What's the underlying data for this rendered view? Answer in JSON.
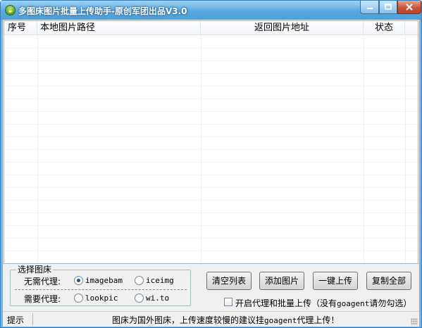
{
  "window": {
    "title": "多图床图片批量上传助手-原创军团出品V3.0",
    "controls": {
      "minimize": "—",
      "maximize": "☐",
      "close": "✕"
    }
  },
  "list": {
    "columns": [
      "序号",
      "本地图片路径",
      "返回图片地址",
      "状态"
    ],
    "rows": []
  },
  "host_group": {
    "title": "选择图床",
    "no_proxy_label": "无需代理:",
    "proxy_label": "需要代理:",
    "options": {
      "imagebam": {
        "label": "imagebam",
        "checked": true
      },
      "iceimg": {
        "label": "iceimg",
        "checked": false
      },
      "lookpic": {
        "label": "lookpic",
        "checked": false
      },
      "wito": {
        "label": "wi.to",
        "checked": false
      }
    }
  },
  "buttons": {
    "clear": "清空列表",
    "add": "添加图片",
    "upload": "一键上传",
    "copy": "复制全部"
  },
  "proxy_checkbox": {
    "label_prefix": "开启代理和批量上传（没有",
    "label_mono": "goagent",
    "label_suffix": "请勿勾选）",
    "checked": false
  },
  "statusbar": {
    "hint": "提示",
    "msg_prefix": "图床为国外图床，上传速度较慢的建议挂",
    "msg_mono": "goagent",
    "msg_suffix": "代理上传！"
  },
  "colors": {
    "titlebar": "#5aa9df",
    "close_button": "#c8553b",
    "client_bg": "#f0f0f0"
  }
}
